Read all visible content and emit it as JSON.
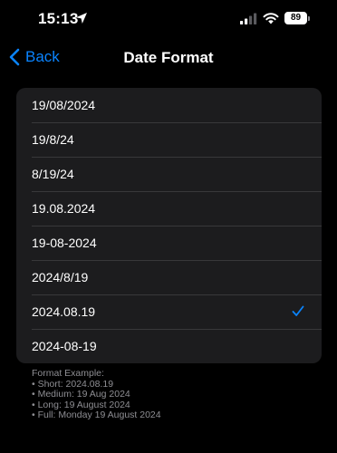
{
  "status_bar": {
    "time": "15:13",
    "battery": "89",
    "icons": [
      "location-arrow-icon",
      "cellular-signal-icon",
      "wifi-icon",
      "battery-icon"
    ]
  },
  "nav": {
    "back_label": "Back",
    "title": "Date Format"
  },
  "options": [
    {
      "label": "19/08/2024",
      "selected": false
    },
    {
      "label": "19/8/24",
      "selected": false
    },
    {
      "label": "8/19/24",
      "selected": false
    },
    {
      "label": "19.08.2024",
      "selected": false
    },
    {
      "label": "19-08-2024",
      "selected": false
    },
    {
      "label": "2024/8/19",
      "selected": false
    },
    {
      "label": "2024.08.19",
      "selected": true
    },
    {
      "label": "2024-08-19",
      "selected": false
    }
  ],
  "footer": {
    "heading": "Format Example:",
    "examples": [
      "• Short: 2024.08.19",
      "• Medium: 19 Aug 2024",
      "• Long: 19 August 2024",
      "• Full: Monday 19 August 2024"
    ]
  },
  "colors": {
    "background": "#000000",
    "group": "#1c1c1e",
    "separator": "#38383a",
    "accent": "#0a84ff",
    "secondary_text": "#8e8e93"
  }
}
